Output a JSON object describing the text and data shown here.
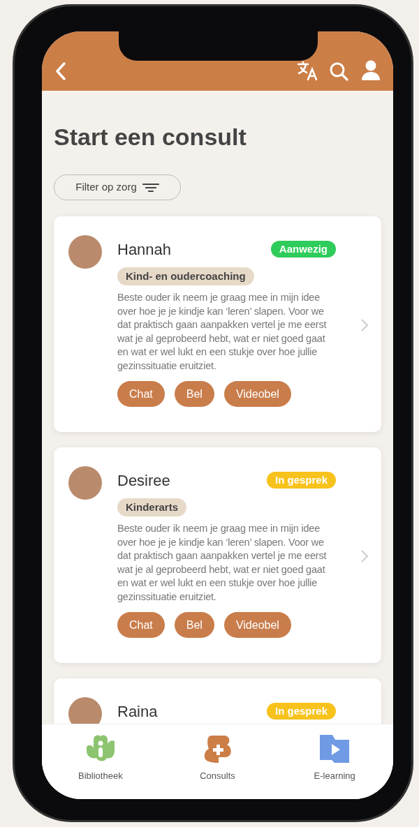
{
  "header": {
    "title": "Start een consult"
  },
  "filter": {
    "label": "Filter op zorg"
  },
  "consultants": [
    {
      "name": "Hannah",
      "status": {
        "label": "Aanwezig",
        "color": "#2ecc5a"
      },
      "specialty": "Kind- en oudercoaching",
      "description": "Beste ouder ik neem je graag mee in mijn idee over hoe je je kindje kan ‘leren’ slapen. Voor we dat praktisch gaan aanpakken vertel je me eerst wat je al geprobeerd hebt, wat er niet goed gaat en wat er wel lukt en een stukje over hoe jullie gezinssituatie eruitziet.",
      "actions": [
        "Chat",
        "Bel",
        "Videobel"
      ]
    },
    {
      "name": "Desiree",
      "status": {
        "label": "In gesprek",
        "color": "#f7c21b"
      },
      "specialty": "Kinderarts",
      "description": "Beste ouder ik neem je graag mee in mijn idee over hoe je je kindje kan ‘leren’ slapen. Voor we dat praktisch gaan aanpakken vertel je me eerst wat je al geprobeerd hebt, wat er niet goed gaat en wat er wel lukt en een stukje over hoe jullie gezinssituatie eruitziet.",
      "actions": [
        "Chat",
        "Bel",
        "Videobel"
      ]
    },
    {
      "name": "Raina",
      "status": {
        "label": "In gesprek",
        "color": "#f7c21b"
      }
    }
  ],
  "bottom_nav": [
    {
      "kind": "library",
      "label": "Bibliotheek"
    },
    {
      "kind": "consults",
      "label": "Consults"
    },
    {
      "kind": "elearning",
      "label": "E-learning"
    }
  ]
}
